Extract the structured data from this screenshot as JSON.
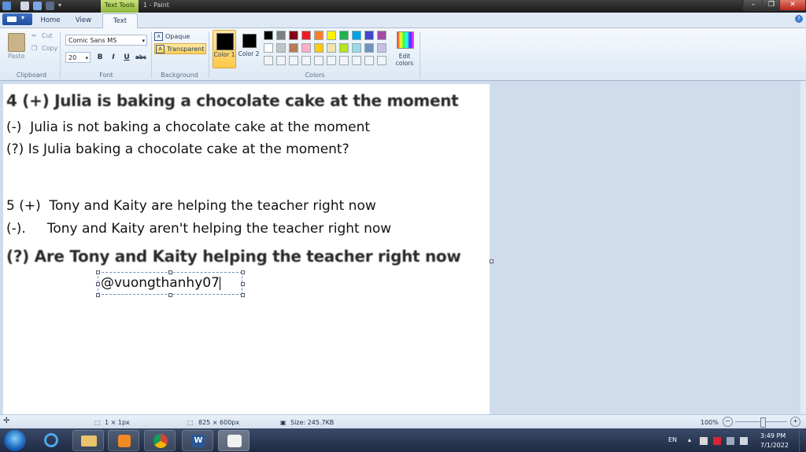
{
  "window": {
    "title": "1 - Paint",
    "context_tab": "Text Tools"
  },
  "tabs": {
    "home": "Home",
    "view": "View",
    "text": "Text"
  },
  "ribbon": {
    "clipboard": {
      "paste": "Paste",
      "cut": "Cut",
      "copy": "Copy",
      "label": "Clipboard"
    },
    "font": {
      "name": "Comic Sans MS",
      "size": "20",
      "bold": "B",
      "italic": "I",
      "underline": "U",
      "strike": "abc",
      "label": "Font"
    },
    "background": {
      "opaque": "Opaque",
      "transparent": "Transparent",
      "label": "Background"
    },
    "colors": {
      "color1": "Color 1",
      "color2": "Color 2",
      "edit": "Edit colors",
      "label": "Colors",
      "palette_row1": [
        "#000000",
        "#7f7f7f",
        "#880015",
        "#ed1c24",
        "#ff7f27",
        "#fff200",
        "#22b14c",
        "#00a2e8",
        "#3f48cc",
        "#a349a4"
      ],
      "palette_row2": [
        "#ffffff",
        "#c3c3c3",
        "#b97a57",
        "#ffaec9",
        "#ffc90e",
        "#efe4b0",
        "#b5e61d",
        "#99d9ea",
        "#7092be",
        "#c8bfe7"
      ]
    }
  },
  "canvas": {
    "lines": [
      "4 (+) Julia is baking a chocolate cake at the moment",
      "(-)  Julia is not baking a chocolate cake at the moment",
      "(?) Is Julia baking a chocolate cake at the moment?",
      "5 (+)  Tony and Kaity are helping the teacher right now",
      "(-).     Tony and Kaity aren't helping the teacher right now",
      "(?) Are Tony and Kaity helping the teacher right now"
    ],
    "textbox": "@vuongthanhy07"
  },
  "statusbar": {
    "selection": "1 × 1px",
    "dimensions": "825 × 600px",
    "size": "Size: 245.7KB",
    "zoom": "100%"
  },
  "taskbar": {
    "lang": "EN",
    "time": "3:49 PM",
    "date": "7/1/2022"
  }
}
